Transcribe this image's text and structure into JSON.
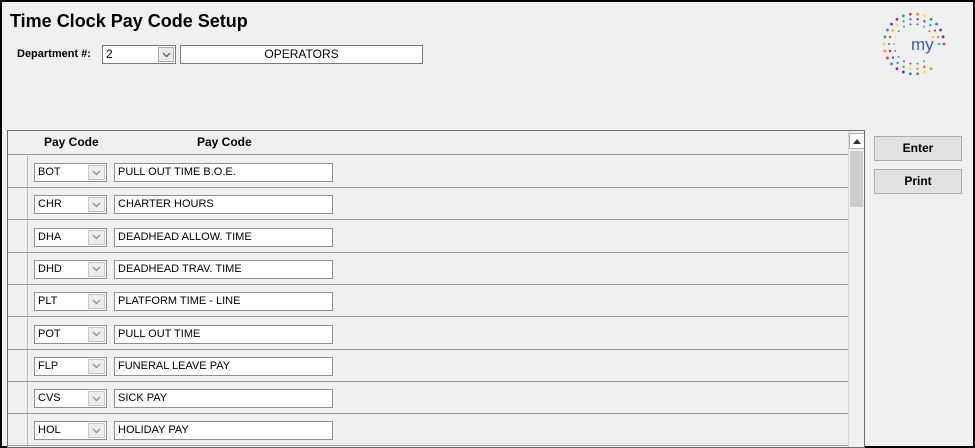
{
  "title": "Time Clock Pay Code Setup",
  "department": {
    "label": "Department #:",
    "value": "2",
    "name": "OPERATORS"
  },
  "logo": {
    "text": "my"
  },
  "grid": {
    "headers": [
      "Pay Code",
      "Pay Code"
    ],
    "rows": [
      {
        "code": "BOT",
        "description": "PULL OUT TIME B.O.E."
      },
      {
        "code": "CHR",
        "description": "CHARTER HOURS"
      },
      {
        "code": "DHA",
        "description": "DEADHEAD ALLOW. TIME"
      },
      {
        "code": "DHD",
        "description": "DEADHEAD TRAV. TIME"
      },
      {
        "code": "PLT",
        "description": "PLATFORM TIME - LINE"
      },
      {
        "code": "POT",
        "description": "PULL OUT TIME"
      },
      {
        "code": "FLP",
        "description": "FUNERAL LEAVE PAY"
      },
      {
        "code": "CVS",
        "description": "SICK PAY"
      },
      {
        "code": "HOL",
        "description": "HOLIDAY PAY"
      }
    ]
  },
  "buttons": {
    "enter": "Enter",
    "print": "Print"
  },
  "icons": {
    "dropdown": "chevron-down-icon",
    "scroll_up": "scroll-up-arrow-icon"
  }
}
